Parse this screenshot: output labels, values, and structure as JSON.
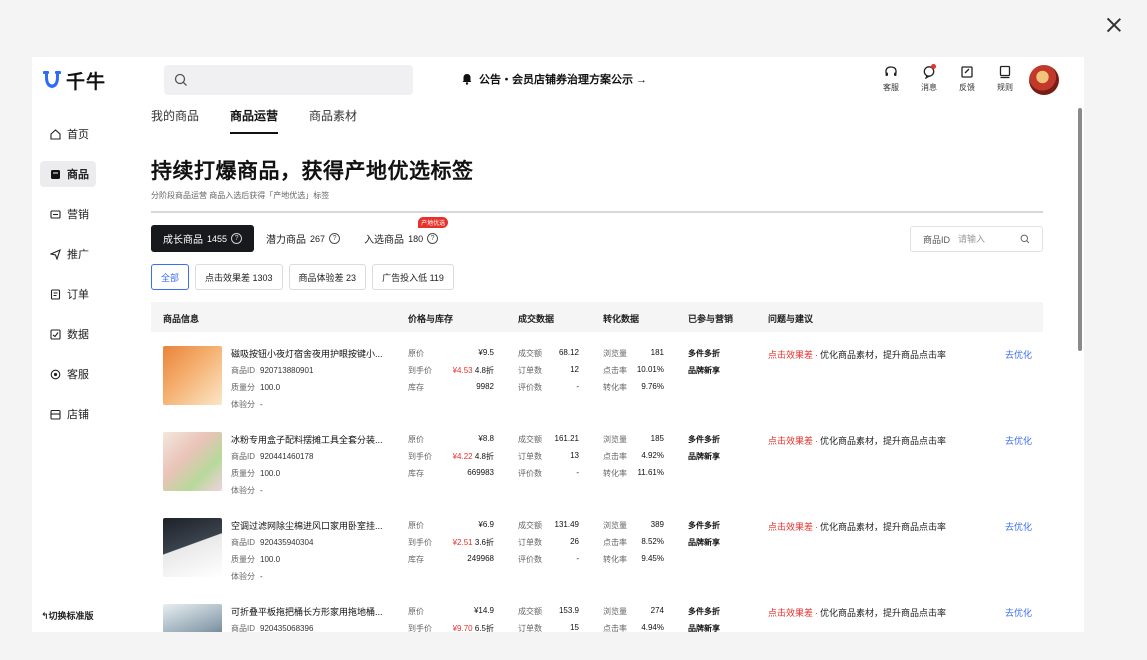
{
  "app": {
    "name": "千牛"
  },
  "header": {
    "notice": "公告・会员店铺券治理方案公示 →",
    "icons": [
      {
        "icon": "headset-icon",
        "label": "客服"
      },
      {
        "icon": "message-icon",
        "label": "消息"
      },
      {
        "icon": "feedback-icon",
        "label": "反馈"
      },
      {
        "icon": "rules-icon",
        "label": "规则"
      }
    ]
  },
  "sidebar": {
    "items": [
      {
        "icon": "home-icon",
        "label": "首页"
      },
      {
        "icon": "product-icon",
        "label": "商品"
      },
      {
        "icon": "marketing-icon",
        "label": "营销"
      },
      {
        "icon": "promote-icon",
        "label": "推广"
      },
      {
        "icon": "order-icon",
        "label": "订单"
      },
      {
        "icon": "data-icon",
        "label": "数据"
      },
      {
        "icon": "service-icon",
        "label": "客服"
      },
      {
        "icon": "store-icon",
        "label": "店铺"
      }
    ],
    "active": "商品",
    "switch_label": "↰切换标准版"
  },
  "tabs": [
    "我的商品",
    "商品运营",
    "商品素材"
  ],
  "hero": {
    "title": "持续打爆商品，获得产地优选标签",
    "subtitle": "分阶段商品运营 商品入选后获得「产地优选」标签"
  },
  "segments": [
    {
      "label": "成长商品",
      "count": "1455"
    },
    {
      "label": "潜力商品",
      "count": "267"
    },
    {
      "label": "入选商品",
      "count": "180",
      "tag": "产地优选"
    }
  ],
  "pid_search": {
    "label": "商品ID",
    "placeholder": "请输入"
  },
  "filters": [
    "全部",
    "点击效果差 1303",
    "商品体验差 23",
    "广告投入低 119"
  ],
  "columns": [
    "商品信息",
    "价格与库存",
    "成交数据",
    "转化数据",
    "已参与营销",
    "问题与建议"
  ],
  "row_labels": {
    "id": "商品ID",
    "quality": "质量分",
    "experience": "体验分",
    "orig_price": "原价",
    "final_price": "到手价",
    "stock": "库存",
    "gmv": "成交额",
    "orders": "订单数",
    "reviews": "评价数",
    "views": "浏览量",
    "ctr": "点击率",
    "cvr": "转化率",
    "promo1": "多件多折",
    "promo2": "品牌新享",
    "issue_bad": "点击效果差",
    "issue_sep": "·",
    "issue_text": "优化商品素材，提升商品点击率",
    "action": "去优化"
  },
  "products": [
    {
      "title": "磁吸按钮小夜灯宿舍夜用护眼按键小...",
      "id": "920713880901",
      "quality": "100.0",
      "experience": "-",
      "orig_price": "¥9.5",
      "final_price": "¥4.53",
      "discount": "4.8折",
      "stock": "9982",
      "gmv": "68.12",
      "orders": "12",
      "reviews": "-",
      "views": "181",
      "ctr": "10.01%",
      "cvr": "9.76%"
    },
    {
      "title": "冰粉专用盒子配料摆摊工具全套分装...",
      "id": "920441460178",
      "quality": "100.0",
      "experience": "-",
      "orig_price": "¥8.8",
      "final_price": "¥4.22",
      "discount": "4.8折",
      "stock": "669983",
      "gmv": "161.21",
      "orders": "13",
      "reviews": "-",
      "views": "185",
      "ctr": "4.92%",
      "cvr": "11.61%"
    },
    {
      "title": "空调过滤网除尘棉进风口家用卧室挂...",
      "id": "920435940304",
      "quality": "100.0",
      "experience": "-",
      "orig_price": "¥6.9",
      "final_price": "¥2.51",
      "discount": "3.6折",
      "stock": "249968",
      "gmv": "131.49",
      "orders": "26",
      "reviews": "-",
      "views": "389",
      "ctr": "8.52%",
      "cvr": "9.45%"
    },
    {
      "title": "可折叠平板拖把桶长方形家用拖地桶...",
      "id": "920435068396",
      "quality": "",
      "experience": "",
      "orig_price": "¥14.9",
      "final_price": "¥9.70",
      "discount": "6.5折",
      "stock": "",
      "gmv": "153.9",
      "orders": "15",
      "reviews": "",
      "views": "274",
      "ctr": "4.94%",
      "cvr": ""
    }
  ]
}
